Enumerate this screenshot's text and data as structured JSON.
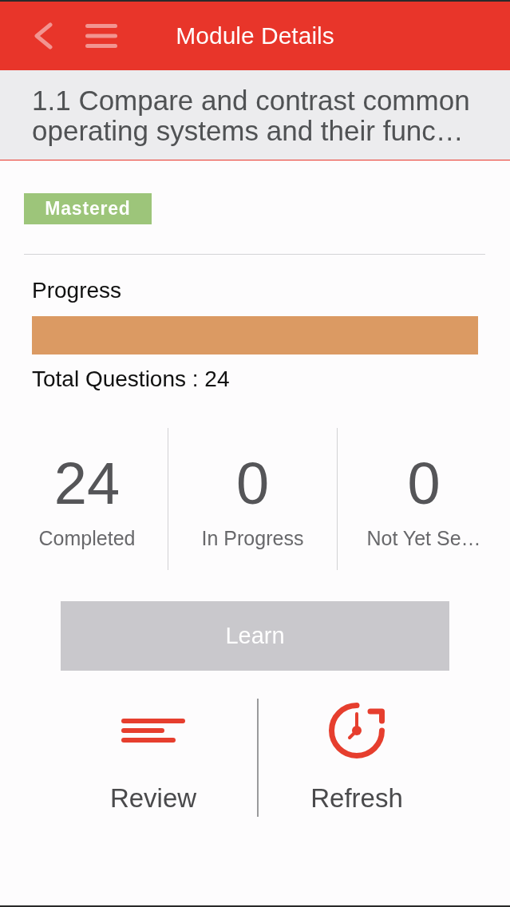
{
  "header": {
    "title": "Module Details"
  },
  "module": {
    "title": "1.1 Compare and contrast common operating systems and their func…"
  },
  "status_badge": {
    "label": "Mastered"
  },
  "progress": {
    "label": "Progress",
    "level": 1,
    "total": "Total Questions : 24"
  },
  "stats": [
    {
      "value": "24",
      "label": "Completed"
    },
    {
      "value": "0",
      "label": "In Progress"
    },
    {
      "value": "0",
      "label": "Not Yet Se…"
    }
  ],
  "learn_button": {
    "label": "Learn",
    "disabled": true
  },
  "actions": [
    {
      "kind": "review",
      "label": "Review"
    },
    {
      "kind": "refresh",
      "label": "Refresh"
    }
  ]
}
